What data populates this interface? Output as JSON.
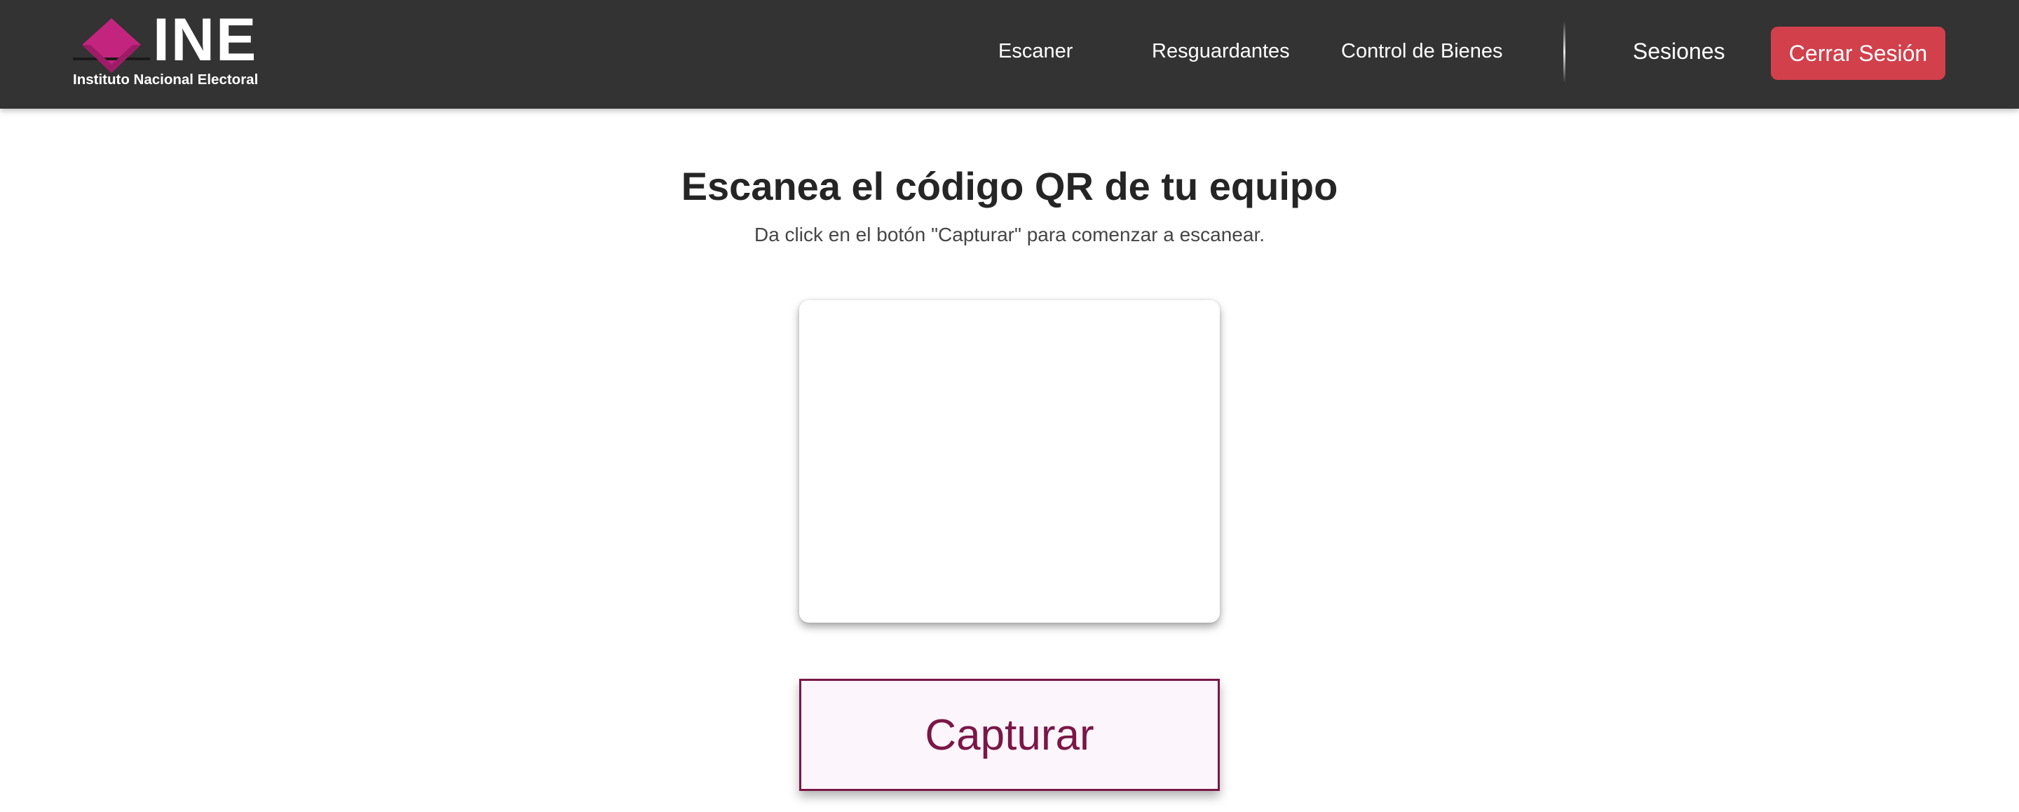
{
  "brand": {
    "logo_text": "INE",
    "tagline": "Instituto Nacional Electoral",
    "accent_color": "#c3247e"
  },
  "nav": {
    "links": [
      {
        "label": "Escaner"
      },
      {
        "label": "Resguardantes"
      },
      {
        "label": "Control de Bienes"
      }
    ],
    "sessions_label": "Sesiones",
    "logout_label": "Cerrar Sesión",
    "logout_color": "#d1404b"
  },
  "main": {
    "title": "Escanea el código QR de tu equipo",
    "subtitle": "Da click en el botón \"Capturar\" para comenzar a escanear.",
    "capture_label": "Capturar",
    "capture_color": "#7a1747"
  },
  "icons": {
    "logo": "ine-diamond-logo-icon"
  }
}
